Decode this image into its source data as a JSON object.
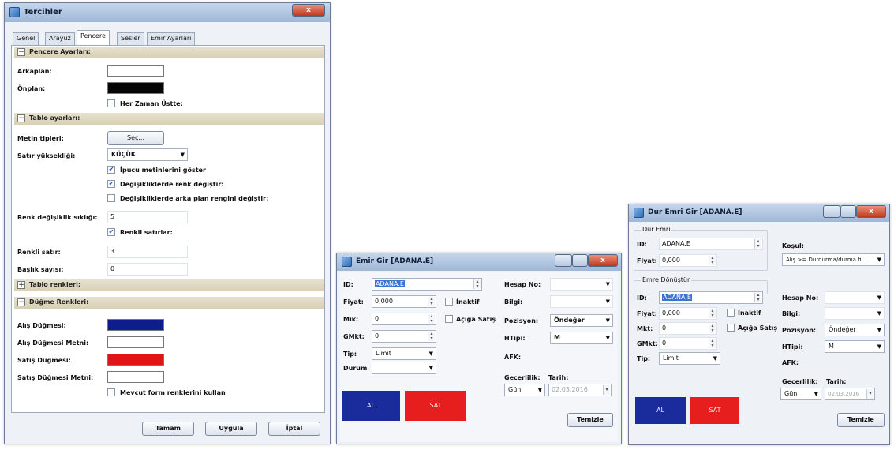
{
  "pref": {
    "title": "Tercihler",
    "close": "x",
    "tabs": [
      "Genel",
      "Arayüz",
      "Pencere",
      "Sesler",
      "Emir Ayarları"
    ],
    "sections": {
      "pencere": "Pencere Ayarları:",
      "tablo": "Tablo ayarları:",
      "tablo_renk": "Tablo renkleri:",
      "dugme": "Düğme Renkleri:"
    },
    "arkaplan_label": "Arkaplan:",
    "onplan_label": "Önplan:",
    "her_zaman_label": "Her Zaman Üstte:",
    "metin_label": "Metin tipleri:",
    "sec_button": "Seç...",
    "satir_label": "Satır yüksekliği:",
    "satir_value": "KÜÇÜK",
    "ipucu_label": "İpucu metinlerini göster",
    "renk_degistir_label": "Değişikliklerde renk değiştir:",
    "arka_plan_label": "Değişikliklerde arka plan rengini değiştir:",
    "renk_sikligi_label": "Renk değişiklik sıklığı:",
    "renk_sikligi_value": "5",
    "renkli_satirlar_label": "Renkli satırlar:",
    "renkli_satir_label": "Renkli satır:",
    "renkli_satir_value": "3",
    "baslik_label": "Başlık sayısı:",
    "baslik_value": "0",
    "alis_dugme_label": "Alış Düğmesi:",
    "alis_metin_label": "Alış Düğmesi Metni:",
    "satis_dugme_label": "Satış Düğmesi:",
    "satis_metin_label": "Satış Düğmesi Metni:",
    "mevcut_label": "Mevcut form renklerini kullan",
    "tamam": "Tamam",
    "uygula": "Uygula",
    "iptal": "İptal",
    "colors": {
      "onplan": "#050505",
      "alis": "#0d1d8c",
      "satis": "#e01515"
    }
  },
  "emir": {
    "title": "Emir Gir [ADANA.E]",
    "id_label": "ID:",
    "id_value": "ADANA.E",
    "fiyat_label": "Fiyat:",
    "fiyat_value": "0,000",
    "miktar_label": "Mik:",
    "miktar_value": "0",
    "gmik_label": "GMkt:",
    "gmik_value": "0",
    "tip_label": "Tip:",
    "tip_value": "Limit",
    "durum_label": "Durum",
    "inaktif_label": "İnaktif",
    "acga_label": "Açığa Satış",
    "hesap_label": "Hesap No:",
    "bilgi_label": "Bilgi:",
    "pozisyon_label": "Pozisyon:",
    "pozisyon_value": "Öndeğer",
    "htip_label": "HTipi:",
    "htip_value": "M",
    "afk_label": "AFK:",
    "gecerlilik_label": "Gecerlilik:",
    "gecerlilik_value": "Gün",
    "tarih_label": "Tarih:",
    "tarih_value": "02.03.2016",
    "al_label": "AL",
    "sat_label": "SAT",
    "temizle": "Temizle"
  },
  "dur": {
    "title": "Dur Emri Gir [ADANA.E]",
    "dur_emri_group": "Dur Emri",
    "id_label": "ID:",
    "id_value": "ADANA.E",
    "fiyat_label": "Fiyat:",
    "fiyat_value": "0,000",
    "kosul_label": "Koşul:",
    "kosul_value": "Alış >= Durdurma/durma fi...",
    "donustur_group": "Emre Dönüştür",
    "id2_value": "ADANA.E",
    "fiyat2_value": "0,000",
    "miktar_label": "Mkt:",
    "miktar_value": "0",
    "gmik_label": "GMkt:",
    "gmik_value": "0",
    "tip_label": "Tip:",
    "tip_value": "Limit",
    "inaktif_label": "İnaktif",
    "acga_label": "Açığa Satış",
    "hesap_label": "Hesap No:",
    "bilgi_label": "Bilgi:",
    "pozisyon_label": "Pozisyon:",
    "pozisyon_value": "Öndeğer",
    "htip_label": "HTipi:",
    "htip_value": "M",
    "afk_label": "AFK:",
    "gecerlilik_label": "Gecerlilik:",
    "gecerlilik_value": "Gün",
    "tarih_label": "Tarih:",
    "tarih_value": "02.03.2016",
    "al_label": "AL",
    "sat_label": "SAT",
    "temizle": "Temizle"
  }
}
